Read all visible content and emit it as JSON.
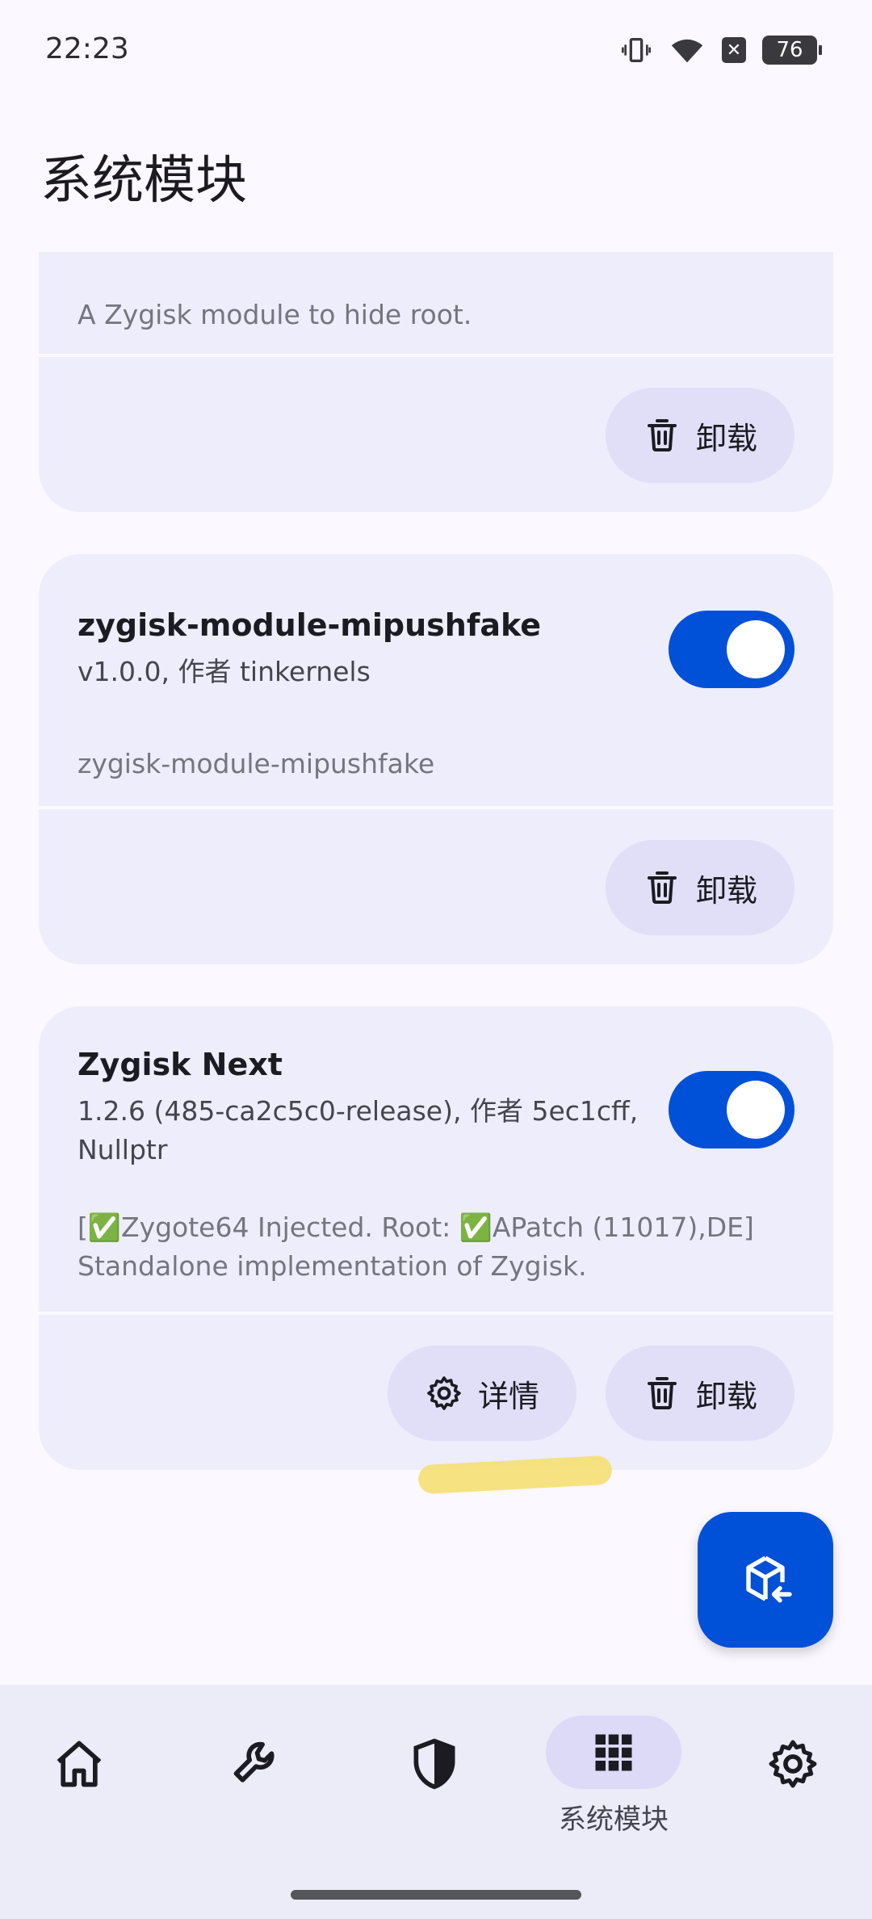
{
  "status_bar": {
    "time": "22:23",
    "battery": "76"
  },
  "page": {
    "title": "系统模块"
  },
  "modules": [
    {
      "name": "",
      "meta": "",
      "description": "A Zygisk module to hide root.",
      "uninstall_label": "卸载"
    },
    {
      "name": "zygisk-module-mipushfake",
      "meta": "v1.0.0, 作者 tinkernels",
      "description": "zygisk-module-mipushfake",
      "enabled": true,
      "uninstall_label": "卸载"
    },
    {
      "name": "Zygisk Next",
      "meta_line1": "1.2.6 (485-ca2c5c0-release), 作者 5ec1cff,",
      "meta_line2": "Nullptr",
      "desc_line1": "[✅Zygote64 Injected. Root: ✅APatch (11017),DE]",
      "desc_line2": "Standalone implementation of Zygisk.",
      "enabled": true,
      "details_label": "详情",
      "uninstall_label": "卸载"
    }
  ],
  "bottom_nav": {
    "items": [
      {
        "icon": "home-icon",
        "label": ""
      },
      {
        "icon": "wrench-icon",
        "label": ""
      },
      {
        "icon": "shield-icon",
        "label": ""
      },
      {
        "icon": "modules-grid-icon",
        "label": "系统模块",
        "active": true
      },
      {
        "icon": "gear-icon",
        "label": ""
      }
    ]
  },
  "colors": {
    "accent": "#0050D8",
    "card_bg": "#EEEDFB",
    "button_bg": "#E1DFF8",
    "page_bg": "#FBF8FF"
  }
}
